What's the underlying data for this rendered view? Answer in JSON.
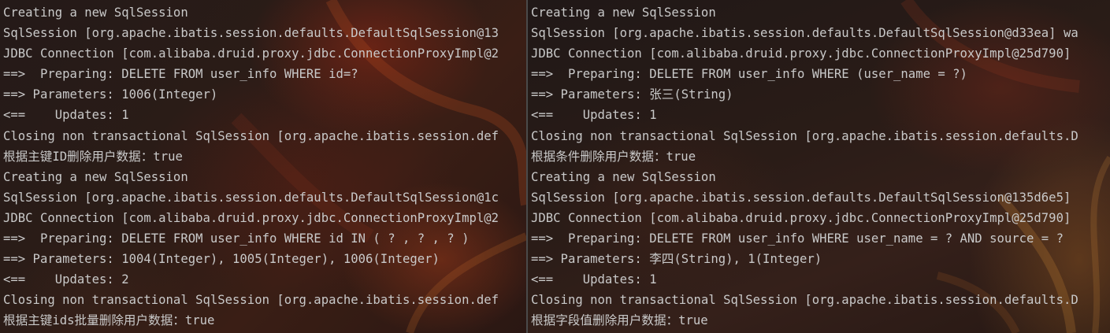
{
  "colors": {
    "text": "#c9c9c9",
    "divider": "#4a4a4a"
  },
  "left_panel": {
    "lines": [
      "Creating a new SqlSession",
      "SqlSession [org.apache.ibatis.session.defaults.DefaultSqlSession@13",
      "JDBC Connection [com.alibaba.druid.proxy.jdbc.ConnectionProxyImpl@2",
      "==>  Preparing: DELETE FROM user_info WHERE id=?",
      "==> Parameters: 1006(Integer)",
      "<==    Updates: 1",
      "Closing non transactional SqlSession [org.apache.ibatis.session.def",
      "根据主键ID删除用户数据：true",
      "Creating a new SqlSession",
      "SqlSession [org.apache.ibatis.session.defaults.DefaultSqlSession@1c",
      "JDBC Connection [com.alibaba.druid.proxy.jdbc.ConnectionProxyImpl@2",
      "==>  Preparing: DELETE FROM user_info WHERE id IN ( ? , ? , ? )",
      "==> Parameters: 1004(Integer), 1005(Integer), 1006(Integer)",
      "<==    Updates: 2",
      "Closing non transactional SqlSession [org.apache.ibatis.session.def",
      "根据主键ids批量删除用户数据：true"
    ]
  },
  "right_panel": {
    "lines": [
      "Creating a new SqlSession",
      "SqlSession [org.apache.ibatis.session.defaults.DefaultSqlSession@d33ea] wa",
      "JDBC Connection [com.alibaba.druid.proxy.jdbc.ConnectionProxyImpl@25d790]",
      "==>  Preparing: DELETE FROM user_info WHERE (user_name = ?)",
      "==> Parameters: 张三(String)",
      "<==    Updates: 1",
      "Closing non transactional SqlSession [org.apache.ibatis.session.defaults.D",
      "根据条件删除用户数据：true",
      "Creating a new SqlSession",
      "SqlSession [org.apache.ibatis.session.defaults.DefaultSqlSession@135d6e5]",
      "JDBC Connection [com.alibaba.druid.proxy.jdbc.ConnectionProxyImpl@25d790]",
      "==>  Preparing: DELETE FROM user_info WHERE user_name = ? AND source = ?",
      "==> Parameters: 李四(String), 1(Integer)",
      "<==    Updates: 1",
      "Closing non transactional SqlSession [org.apache.ibatis.session.defaults.D",
      "根据字段值删除用户数据：true"
    ]
  }
}
